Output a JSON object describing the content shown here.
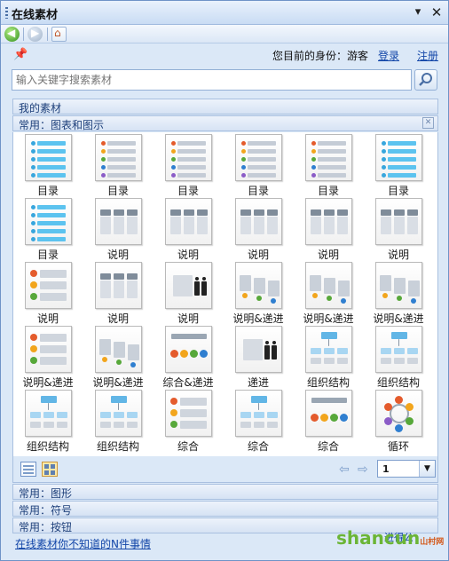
{
  "window": {
    "title": "在线素材"
  },
  "user": {
    "identity_label": "您目前的身份：游客",
    "login": "登录",
    "register": "注册"
  },
  "search": {
    "placeholder": "输入关键字搜索素材"
  },
  "sections": {
    "my": "我的素材",
    "common_charts": "常用：图表和图示",
    "common_shapes": "常用：图形",
    "common_symbols": "常用：符号",
    "common_buttons": "常用：按钮"
  },
  "items": [
    {
      "label": "目录",
      "thumb": "list-blue"
    },
    {
      "label": "目录",
      "thumb": "list-multi"
    },
    {
      "label": "目录",
      "thumb": "list-multi"
    },
    {
      "label": "目录",
      "thumb": "list-multi"
    },
    {
      "label": "目录",
      "thumb": "list-multi"
    },
    {
      "label": "目录",
      "thumb": "list-blue"
    },
    {
      "label": "目录",
      "thumb": "list-blue"
    },
    {
      "label": "说明",
      "thumb": "cols"
    },
    {
      "label": "说明",
      "thumb": "cols"
    },
    {
      "label": "说明",
      "thumb": "cols"
    },
    {
      "label": "说明",
      "thumb": "cols"
    },
    {
      "label": "说明",
      "thumb": "cols"
    },
    {
      "label": "说明",
      "thumb": "rows"
    },
    {
      "label": "说明",
      "thumb": "cols"
    },
    {
      "label": "说明",
      "thumb": "people"
    },
    {
      "label": "说明&递进",
      "thumb": "steps"
    },
    {
      "label": "说明&递进",
      "thumb": "steps"
    },
    {
      "label": "说明&递进",
      "thumb": "steps"
    },
    {
      "label": "说明&递进",
      "thumb": "rows"
    },
    {
      "label": "说明&递进",
      "thumb": "steps"
    },
    {
      "label": "综合&递进",
      "thumb": "balls"
    },
    {
      "label": "递进",
      "thumb": "people"
    },
    {
      "label": "组织结构",
      "thumb": "org"
    },
    {
      "label": "组织结构",
      "thumb": "org"
    },
    {
      "label": "组织结构",
      "thumb": "org"
    },
    {
      "label": "组织结构",
      "thumb": "org"
    },
    {
      "label": "综合",
      "thumb": "rows"
    },
    {
      "label": "综合",
      "thumb": "org"
    },
    {
      "label": "综合",
      "thumb": "balls"
    },
    {
      "label": "循环",
      "thumb": "cycle"
    }
  ],
  "pager": {
    "page": "1"
  },
  "footer": {
    "link": "在线素材你不知道的N件事情",
    "hot": "进得公"
  },
  "watermark": {
    "main": "shancun",
    "sub": "山村网"
  },
  "icons": [
    "back-icon",
    "forward-icon",
    "home-icon",
    "pin-icon",
    "search-icon",
    "close-icon",
    "dropdown-icon",
    "list-view-icon",
    "thumbnail-view-icon",
    "prev-page-icon",
    "next-page-icon"
  ]
}
